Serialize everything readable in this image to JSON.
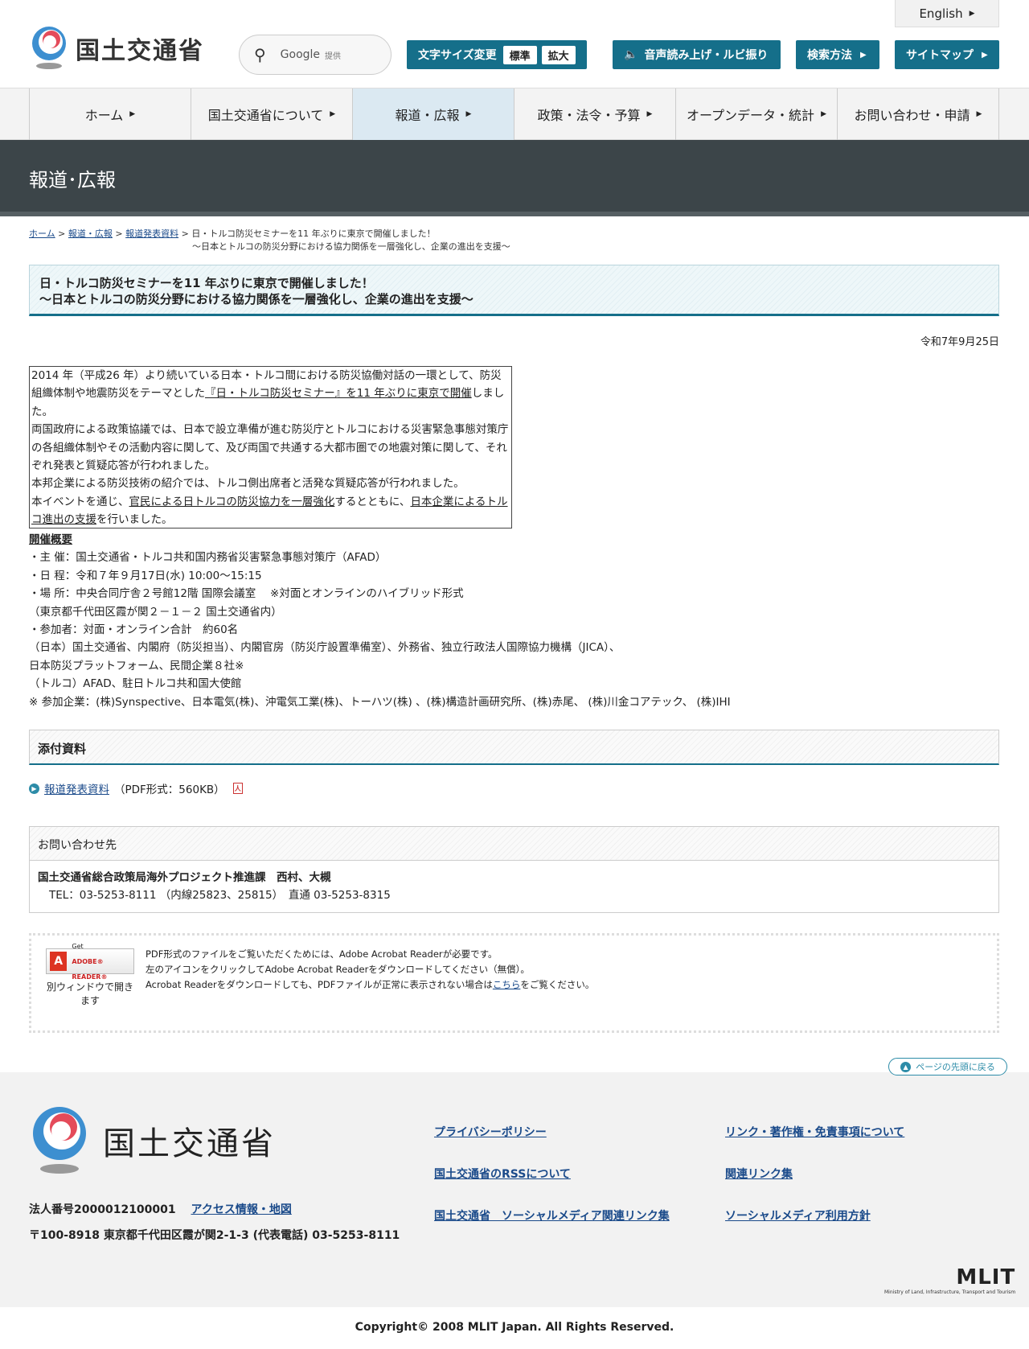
{
  "header": {
    "logo_text": "国土交通省",
    "search": {
      "label": "Google",
      "sub": "提供"
    },
    "font_size": {
      "label": "文字サイズ変更",
      "standard": "標準",
      "large": "拡大"
    },
    "speech_button": "音声読み上げ・ルビ振り",
    "search_method_button": "検索方法",
    "sitemap_button": "サイトマップ",
    "english_button": "English"
  },
  "nav": {
    "items": [
      {
        "label": "ホーム"
      },
      {
        "label": "国土交通省について"
      },
      {
        "label": "報道・広報"
      },
      {
        "label": "政策・法令・予算"
      },
      {
        "label": "オープンデータ・統計"
      },
      {
        "label": "お問い合わせ・申請"
      }
    ]
  },
  "page_title": "報道･広報",
  "breadcrumb": {
    "home": "ホーム",
    "press": "報道・広報",
    "releases": "報道発表資料",
    "current": "日・トルコ防災セミナーを11 年ぶりに東京で開催しました！",
    "current_sub": "～日本とトルコの防災分野における協力関係を一層強化し、企業の進出を支援～"
  },
  "article": {
    "title_line1": "日・トルコ防災セミナーを11 年ぶりに東京で開催しました！",
    "title_line2": "～日本とトルコの防災分野における協力関係を一層強化し、企業の進出を支援～",
    "date": "令和7年9月25日",
    "summary": {
      "p1_a": "2014 年（平成26 年）より続いている日本・トルコ間における防災協働対話の一環として、防災組織体制や地震防災をテーマとした",
      "p1_link": "『日・トルコ防災セミナー』を11 年ぶりに東京で開催",
      "p1_b": "しました。",
      "p2": "両国政府による政策協議では、日本で設立準備が進む防災庁とトルコにおける災害緊急事態対策庁の各組織体制やその活動内容に関して、及び両国で共通する大都市圏での地震対策に関して、それぞれ発表と質疑応答が行われました。",
      "p3": "本邦企業による防災技術の紹介では、トルコ側出席者と活発な質疑応答が行われました。",
      "p4_a": "本イベントを通じ、",
      "p4_link1": "官民による日トルコの防災協力を一層強化",
      "p4_b": "するとともに、",
      "p4_link2": "日本企業によるトルコ進出の支援",
      "p4_c": "を行いました。"
    },
    "overview": {
      "heading": "開催概要",
      "lines": [
        "・主 催：国土交通省・トルコ共和国内務省災害緊急事態対策庁（AFAD）",
        "・日 程：令和７年９月17日(水) 10:00～15:15",
        "・場 所：中央合同庁舎２号館12階 国際会議室　 ※対面とオンラインのハイブリッド形式",
        "（東京都千代田区霞が関２－１－２ 国土交通省内）",
        "・参加者：対面・オンライン合計　約60名",
        "（日本）国土交通省、内閣府（防災担当）、内閣官房（防災庁設置準備室）、外務省、独立行政法人国際協力機構（JICA）、",
        "日本防災プラットフォーム、民間企業８社※",
        "（トルコ）AFAD、駐日トルコ共和国大使館",
        "※ 参加企業：(株)Synspective、日本電気(株)、沖電気工業(株)、トーハツ(株) 、(株)構造計画研究所、(株)赤尾、 (株)川金コアテック、 (株)IHI"
      ]
    }
  },
  "attachments": {
    "heading": "添付資料",
    "link": "報道発表資料",
    "meta": "（PDF形式：560KB）"
  },
  "contact": {
    "heading": "お問い合わせ先",
    "org": "国土交通省総合政策局海外プロジェクト推進課　西村、大槻",
    "tel": "TEL：03-5253-8111 （内線25823、25815）　直通 03-5253-8315"
  },
  "acrobat": {
    "badge_get": "Get",
    "badge_name": "ADOBE® READER®",
    "caption": "別ウィンドウで開きます",
    "line1": "PDF形式のファイルをご覧いただくためには、Adobe Acrobat Readerが必要です。",
    "line2": "左のアイコンをクリックしてAdobe Acrobat Readerをダウンロードしてください（無償）。",
    "line3_a": "Acrobat Readerをダウンロードしても、PDFファイルが正常に表示されない場合は",
    "line3_link": "こちら",
    "line3_b": "をご覧ください。"
  },
  "back_to_top": "ページの先頭に戻る",
  "footer": {
    "logo_text": "国土交通省",
    "corp_number": "法人番号2000012100001",
    "access_link": "アクセス情報・地図",
    "address": "〒100-8918 東京都千代田区霞が関2-1-3 (代表電話) 03-5253-8111",
    "links": [
      "プライバシーポリシー",
      "リンク・著作権・免責事項について",
      "国土交通省のRSSについて",
      "関連リンク集",
      "国土交通省　ソーシャルメディア関連リンク集",
      "ソーシャルメディア利用方針"
    ],
    "mlit_logo": "MLIT",
    "mlit_sub": "Ministry of Land, Infrastructure, Transport and Tourism",
    "copyright": "Copyright© 2008 MLIT Japan. All Rights Reserved."
  },
  "colors": {
    "teal": "#156f8a",
    "dark_band": "#3c4549",
    "link": "#1a4a8a"
  }
}
